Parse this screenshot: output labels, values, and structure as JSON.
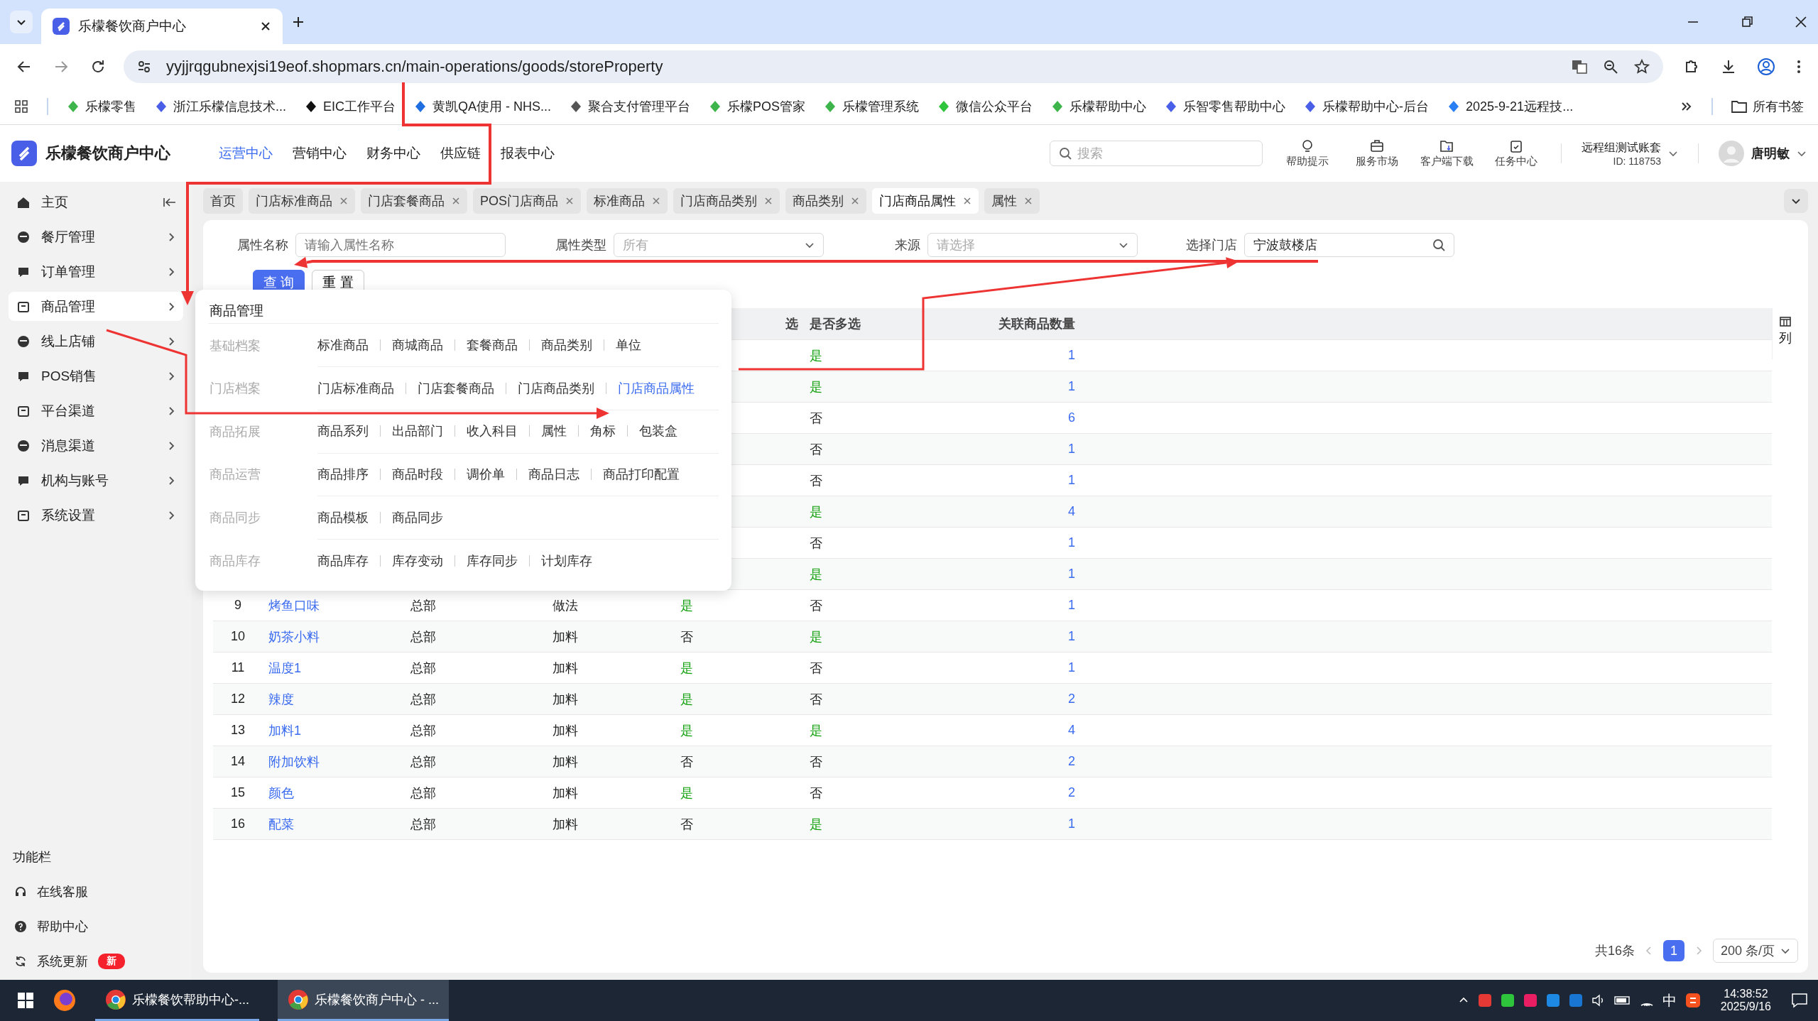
{
  "browser": {
    "tab_title": "乐檬餐饮商户中心",
    "url": "yyjjrqgubnexjsi19eof.shopmars.cn/main-operations/goods/storeProperty",
    "bookmarks": [
      "乐檬零售",
      "浙江乐檬信息技术...",
      "EIC工作平台",
      "黄凯QA使用 - NHS...",
      "聚合支付管理平台",
      "乐檬POS管家",
      "乐檬管理系统",
      "微信公众平台",
      "乐檬帮助中心",
      "乐智零售帮助中心",
      "乐檬帮助中心-后台",
      "2025-9-21远程技..."
    ],
    "all_bookmarks": "所有书签"
  },
  "app": {
    "title": "乐檬餐饮商户中心",
    "nav": [
      {
        "label": "运营中心",
        "selected": true
      },
      {
        "label": "营销中心",
        "selected": false
      },
      {
        "label": "财务中心",
        "selected": false
      },
      {
        "label": "供应链",
        "selected": false
      },
      {
        "label": "报表中心",
        "selected": false
      }
    ],
    "search": {
      "placeholder": "搜索"
    },
    "tools": [
      "帮助提示",
      "服务市场",
      "客户端下载",
      "任务中心"
    ],
    "account": {
      "name": "远程组测试账套",
      "id": "ID: 118753"
    },
    "user": "唐明敏"
  },
  "sidebar": {
    "items": [
      {
        "label": "主页",
        "selected": false,
        "expandable": false
      },
      {
        "label": "餐厅管理",
        "selected": false,
        "expandable": true
      },
      {
        "label": "订单管理",
        "selected": false,
        "expandable": true
      },
      {
        "label": "商品管理",
        "selected": true,
        "expandable": true
      },
      {
        "label": "线上店铺",
        "selected": false,
        "expandable": true
      },
      {
        "label": "POS销售",
        "selected": false,
        "expandable": true
      },
      {
        "label": "平台渠道",
        "selected": false,
        "expandable": true
      },
      {
        "label": "消息渠道",
        "selected": false,
        "expandable": true
      },
      {
        "label": "机构与账号",
        "selected": false,
        "expandable": true
      },
      {
        "label": "系统设置",
        "selected": false,
        "expandable": true
      }
    ],
    "footer_title": "功能栏",
    "footer_items": [
      {
        "label": "在线客服"
      },
      {
        "label": "帮助中心"
      },
      {
        "label": "系统更新",
        "badge": "新"
      }
    ]
  },
  "tabs": [
    {
      "label": "首页",
      "selected": false,
      "closable": false
    },
    {
      "label": "门店标准商品",
      "selected": false,
      "closable": true
    },
    {
      "label": "门店套餐商品",
      "selected": false,
      "closable": true
    },
    {
      "label": "POS门店商品",
      "selected": false,
      "closable": true
    },
    {
      "label": "标准商品",
      "selected": false,
      "closable": true
    },
    {
      "label": "门店商品类别",
      "selected": false,
      "closable": true
    },
    {
      "label": "商品类别",
      "selected": false,
      "closable": true
    },
    {
      "label": "门店商品属性",
      "selected": true,
      "closable": true
    },
    {
      "label": "属性",
      "selected": false,
      "closable": true
    }
  ],
  "filters": [
    {
      "kind": "input",
      "label": "属性名称",
      "placeholder": "请输入属性名称"
    },
    {
      "kind": "select",
      "label": "属性类型",
      "placeholder": "所有"
    },
    {
      "kind": "select",
      "label": "来源",
      "placeholder": "请选择"
    },
    {
      "kind": "search",
      "label": "选择门店",
      "value": "宁波鼓楼店"
    }
  ],
  "buttons": [
    {
      "label": "查 询",
      "primary": true
    },
    {
      "label": "重 置",
      "primary": false
    }
  ],
  "menu": {
    "title": "商品管理",
    "groups": [
      {
        "label": "基础档案",
        "items": [
          {
            "label": "标准商品",
            "selected": false
          },
          {
            "label": "商城商品",
            "selected": false
          },
          {
            "label": "套餐商品",
            "selected": false
          },
          {
            "label": "商品类别",
            "selected": false
          },
          {
            "label": "单位",
            "selected": false
          }
        ]
      },
      {
        "label": "门店档案",
        "items": [
          {
            "label": "门店标准商品",
            "selected": false
          },
          {
            "label": "门店套餐商品",
            "selected": false
          },
          {
            "label": "门店商品类别",
            "selected": false
          },
          {
            "label": "门店商品属性",
            "selected": true
          }
        ]
      },
      {
        "label": "商品拓展",
        "items": [
          {
            "label": "商品系列",
            "selected": false
          },
          {
            "label": "出品部门",
            "selected": false
          },
          {
            "label": "收入科目",
            "selected": false
          },
          {
            "label": "属性",
            "selected": false
          },
          {
            "label": "角标",
            "selected": false
          },
          {
            "label": "包装盒",
            "selected": false
          }
        ]
      },
      {
        "label": "商品运营",
        "items": [
          {
            "label": "商品排序",
            "selected": false
          },
          {
            "label": "商品时段",
            "selected": false
          },
          {
            "label": "调价单",
            "selected": false
          },
          {
            "label": "商品日志",
            "selected": false
          },
          {
            "label": "商品打印配置",
            "selected": false
          }
        ]
      },
      {
        "label": "商品同步",
        "items": [
          {
            "label": "商品模板",
            "selected": false
          },
          {
            "label": "商品同步",
            "selected": false
          }
        ]
      },
      {
        "label": "商品库存",
        "items": [
          {
            "label": "商品库存",
            "selected": false
          },
          {
            "label": "库存变动",
            "selected": false
          },
          {
            "label": "库存同步",
            "selected": false
          },
          {
            "label": "计划库存",
            "selected": false
          }
        ]
      }
    ]
  },
  "table": {
    "columns": [
      "选",
      "是否多选",
      "关联商品数量"
    ],
    "column_settings": "列",
    "rows": [
      {
        "multi": {
          "text": "是",
          "on": true
        },
        "count": "1"
      },
      {
        "multi": {
          "text": "是",
          "on": true
        },
        "count": "1"
      },
      {
        "multi": {
          "text": "否",
          "on": false
        },
        "count": "6"
      },
      {
        "multi": {
          "text": "否",
          "on": false
        },
        "count": "1"
      },
      {
        "multi": {
          "text": "否",
          "on": false
        },
        "count": "1"
      },
      {
        "multi": {
          "text": "是",
          "on": true
        },
        "count": "4"
      },
      {
        "multi": {
          "text": "否",
          "on": false
        },
        "count": "1"
      },
      {
        "multi": {
          "text": "是",
          "on": true
        },
        "count": "1"
      },
      {
        "no": "9",
        "name": "烤鱼口味",
        "source": "总部",
        "type": "做法",
        "required": {
          "text": "是",
          "on": true
        },
        "multi": {
          "text": "否",
          "on": false
        },
        "count": "1"
      },
      {
        "no": "10",
        "name": "奶茶小料",
        "source": "总部",
        "type": "加料",
        "required": {
          "text": "否",
          "on": false
        },
        "multi": {
          "text": "是",
          "on": true
        },
        "count": "1"
      },
      {
        "no": "11",
        "name": "温度1",
        "source": "总部",
        "type": "加料",
        "required": {
          "text": "是",
          "on": true
        },
        "multi": {
          "text": "否",
          "on": false
        },
        "count": "1"
      },
      {
        "no": "12",
        "name": "辣度",
        "source": "总部",
        "type": "加料",
        "required": {
          "text": "是",
          "on": true
        },
        "multi": {
          "text": "否",
          "on": false
        },
        "count": "2"
      },
      {
        "no": "13",
        "name": "加料1",
        "source": "总部",
        "type": "加料",
        "required": {
          "text": "是",
          "on": true
        },
        "multi": {
          "text": "是",
          "on": true
        },
        "count": "4"
      },
      {
        "no": "14",
        "name": "附加饮料",
        "source": "总部",
        "type": "加料",
        "required": {
          "text": "否",
          "on": false
        },
        "multi": {
          "text": "否",
          "on": false
        },
        "count": "2"
      },
      {
        "no": "15",
        "name": "颜色",
        "source": "总部",
        "type": "加料",
        "required": {
          "text": "是",
          "on": true
        },
        "multi": {
          "text": "否",
          "on": false
        },
        "count": "2"
      },
      {
        "no": "16",
        "name": "配菜",
        "source": "总部",
        "type": "加料",
        "required": {
          "text": "否",
          "on": false
        },
        "multi": {
          "text": "是",
          "on": true
        },
        "count": "1"
      }
    ]
  },
  "pagination": {
    "total": "共16条",
    "pages": [
      {
        "label": "1",
        "selected": true
      }
    ],
    "page_size": "200 条/页"
  },
  "taskbar": {
    "windows": [
      {
        "label": "乐檬餐饮帮助中心-...",
        "selected": false
      },
      {
        "label": "乐檬餐饮商户中心 - ...",
        "selected": true
      }
    ],
    "ime": "中",
    "time": "14:38:52",
    "date": "2025/9/16"
  }
}
